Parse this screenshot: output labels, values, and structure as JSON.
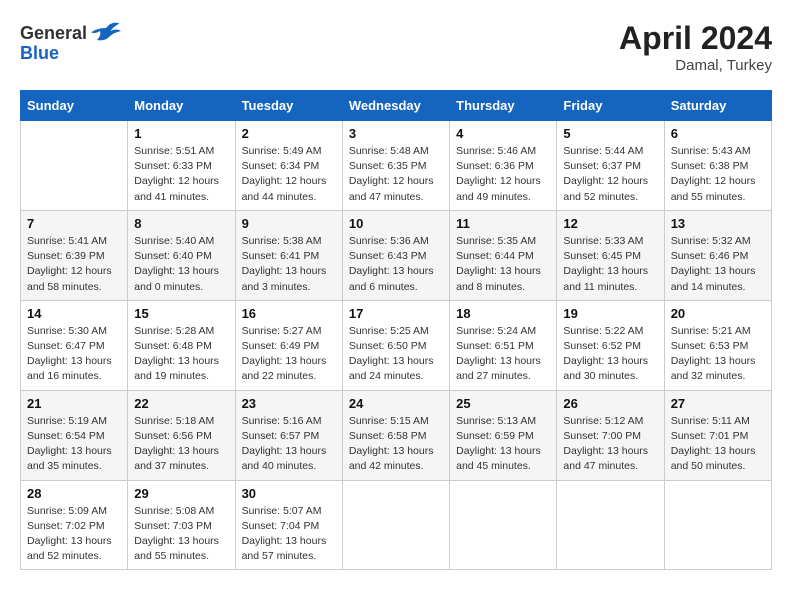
{
  "header": {
    "logo_general": "General",
    "logo_blue": "Blue",
    "month_year": "April 2024",
    "location": "Damal, Turkey"
  },
  "days_of_week": [
    "Sunday",
    "Monday",
    "Tuesday",
    "Wednesday",
    "Thursday",
    "Friday",
    "Saturday"
  ],
  "weeks": [
    [
      {
        "day": "",
        "sunrise": "",
        "sunset": "",
        "daylight": ""
      },
      {
        "day": "1",
        "sunrise": "Sunrise: 5:51 AM",
        "sunset": "Sunset: 6:33 PM",
        "daylight": "Daylight: 12 hours and 41 minutes."
      },
      {
        "day": "2",
        "sunrise": "Sunrise: 5:49 AM",
        "sunset": "Sunset: 6:34 PM",
        "daylight": "Daylight: 12 hours and 44 minutes."
      },
      {
        "day": "3",
        "sunrise": "Sunrise: 5:48 AM",
        "sunset": "Sunset: 6:35 PM",
        "daylight": "Daylight: 12 hours and 47 minutes."
      },
      {
        "day": "4",
        "sunrise": "Sunrise: 5:46 AM",
        "sunset": "Sunset: 6:36 PM",
        "daylight": "Daylight: 12 hours and 49 minutes."
      },
      {
        "day": "5",
        "sunrise": "Sunrise: 5:44 AM",
        "sunset": "Sunset: 6:37 PM",
        "daylight": "Daylight: 12 hours and 52 minutes."
      },
      {
        "day": "6",
        "sunrise": "Sunrise: 5:43 AM",
        "sunset": "Sunset: 6:38 PM",
        "daylight": "Daylight: 12 hours and 55 minutes."
      }
    ],
    [
      {
        "day": "7",
        "sunrise": "Sunrise: 5:41 AM",
        "sunset": "Sunset: 6:39 PM",
        "daylight": "Daylight: 12 hours and 58 minutes."
      },
      {
        "day": "8",
        "sunrise": "Sunrise: 5:40 AM",
        "sunset": "Sunset: 6:40 PM",
        "daylight": "Daylight: 13 hours and 0 minutes."
      },
      {
        "day": "9",
        "sunrise": "Sunrise: 5:38 AM",
        "sunset": "Sunset: 6:41 PM",
        "daylight": "Daylight: 13 hours and 3 minutes."
      },
      {
        "day": "10",
        "sunrise": "Sunrise: 5:36 AM",
        "sunset": "Sunset: 6:43 PM",
        "daylight": "Daylight: 13 hours and 6 minutes."
      },
      {
        "day": "11",
        "sunrise": "Sunrise: 5:35 AM",
        "sunset": "Sunset: 6:44 PM",
        "daylight": "Daylight: 13 hours and 8 minutes."
      },
      {
        "day": "12",
        "sunrise": "Sunrise: 5:33 AM",
        "sunset": "Sunset: 6:45 PM",
        "daylight": "Daylight: 13 hours and 11 minutes."
      },
      {
        "day": "13",
        "sunrise": "Sunrise: 5:32 AM",
        "sunset": "Sunset: 6:46 PM",
        "daylight": "Daylight: 13 hours and 14 minutes."
      }
    ],
    [
      {
        "day": "14",
        "sunrise": "Sunrise: 5:30 AM",
        "sunset": "Sunset: 6:47 PM",
        "daylight": "Daylight: 13 hours and 16 minutes."
      },
      {
        "day": "15",
        "sunrise": "Sunrise: 5:28 AM",
        "sunset": "Sunset: 6:48 PM",
        "daylight": "Daylight: 13 hours and 19 minutes."
      },
      {
        "day": "16",
        "sunrise": "Sunrise: 5:27 AM",
        "sunset": "Sunset: 6:49 PM",
        "daylight": "Daylight: 13 hours and 22 minutes."
      },
      {
        "day": "17",
        "sunrise": "Sunrise: 5:25 AM",
        "sunset": "Sunset: 6:50 PM",
        "daylight": "Daylight: 13 hours and 24 minutes."
      },
      {
        "day": "18",
        "sunrise": "Sunrise: 5:24 AM",
        "sunset": "Sunset: 6:51 PM",
        "daylight": "Daylight: 13 hours and 27 minutes."
      },
      {
        "day": "19",
        "sunrise": "Sunrise: 5:22 AM",
        "sunset": "Sunset: 6:52 PM",
        "daylight": "Daylight: 13 hours and 30 minutes."
      },
      {
        "day": "20",
        "sunrise": "Sunrise: 5:21 AM",
        "sunset": "Sunset: 6:53 PM",
        "daylight": "Daylight: 13 hours and 32 minutes."
      }
    ],
    [
      {
        "day": "21",
        "sunrise": "Sunrise: 5:19 AM",
        "sunset": "Sunset: 6:54 PM",
        "daylight": "Daylight: 13 hours and 35 minutes."
      },
      {
        "day": "22",
        "sunrise": "Sunrise: 5:18 AM",
        "sunset": "Sunset: 6:56 PM",
        "daylight": "Daylight: 13 hours and 37 minutes."
      },
      {
        "day": "23",
        "sunrise": "Sunrise: 5:16 AM",
        "sunset": "Sunset: 6:57 PM",
        "daylight": "Daylight: 13 hours and 40 minutes."
      },
      {
        "day": "24",
        "sunrise": "Sunrise: 5:15 AM",
        "sunset": "Sunset: 6:58 PM",
        "daylight": "Daylight: 13 hours and 42 minutes."
      },
      {
        "day": "25",
        "sunrise": "Sunrise: 5:13 AM",
        "sunset": "Sunset: 6:59 PM",
        "daylight": "Daylight: 13 hours and 45 minutes."
      },
      {
        "day": "26",
        "sunrise": "Sunrise: 5:12 AM",
        "sunset": "Sunset: 7:00 PM",
        "daylight": "Daylight: 13 hours and 47 minutes."
      },
      {
        "day": "27",
        "sunrise": "Sunrise: 5:11 AM",
        "sunset": "Sunset: 7:01 PM",
        "daylight": "Daylight: 13 hours and 50 minutes."
      }
    ],
    [
      {
        "day": "28",
        "sunrise": "Sunrise: 5:09 AM",
        "sunset": "Sunset: 7:02 PM",
        "daylight": "Daylight: 13 hours and 52 minutes."
      },
      {
        "day": "29",
        "sunrise": "Sunrise: 5:08 AM",
        "sunset": "Sunset: 7:03 PM",
        "daylight": "Daylight: 13 hours and 55 minutes."
      },
      {
        "day": "30",
        "sunrise": "Sunrise: 5:07 AM",
        "sunset": "Sunset: 7:04 PM",
        "daylight": "Daylight: 13 hours and 57 minutes."
      },
      {
        "day": "",
        "sunrise": "",
        "sunset": "",
        "daylight": ""
      },
      {
        "day": "",
        "sunrise": "",
        "sunset": "",
        "daylight": ""
      },
      {
        "day": "",
        "sunrise": "",
        "sunset": "",
        "daylight": ""
      },
      {
        "day": "",
        "sunrise": "",
        "sunset": "",
        "daylight": ""
      }
    ]
  ]
}
